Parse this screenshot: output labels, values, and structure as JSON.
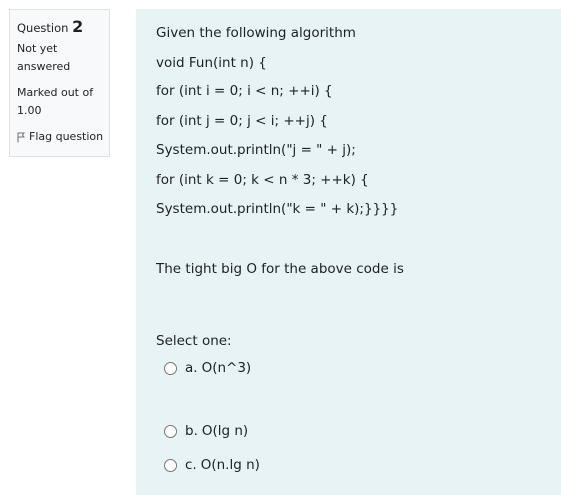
{
  "info": {
    "question_label": "Question",
    "question_number": "2",
    "state": "Not yet answered",
    "grade": "Marked out of 1.00",
    "flag_label": "Flag question"
  },
  "question": {
    "lines": [
      "Given the following algorithm",
      "void Fun(int n) {",
      "for (int i = 0; i < n; ++i) {",
      "for (int j = 0; j < i; ++j) {",
      "System.out.println(\"j = \" + j);",
      "for (int k = 0; k < n * 3; ++k) {",
      "System.out.println(\"k = \" + k);}}}}"
    ],
    "prompt": "The tight big O for the above code is",
    "select_label": "Select one:"
  },
  "options": [
    {
      "letter": "a.",
      "text": "O(n^3)"
    },
    {
      "letter": "b.",
      "text": "O(lg n)"
    },
    {
      "letter": "c.",
      "text": "O(n.lg n)"
    }
  ]
}
